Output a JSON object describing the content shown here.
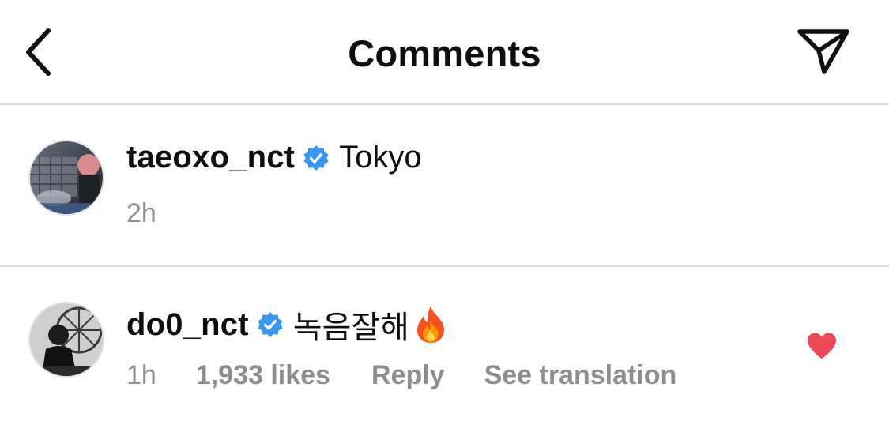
{
  "header": {
    "title": "Comments",
    "back_icon": "chevron-left-icon",
    "share_icon": "paper-plane-icon"
  },
  "comments": [
    {
      "username": "taeoxo_nct",
      "verified": true,
      "text": "Tokyo",
      "time": "2h"
    },
    {
      "username": "do0_nct",
      "verified": true,
      "text": "녹음잘해",
      "emoji": "fire-emoji",
      "time": "1h",
      "likes": "1,933 likes",
      "reply_label": "Reply",
      "translate_label": "See translation",
      "liked": true
    }
  ],
  "colors": {
    "verified_blue": "#3897f0",
    "heart_red": "#ed4956",
    "meta_gray": "#8e8e8e",
    "divider": "#dcdcdc"
  }
}
